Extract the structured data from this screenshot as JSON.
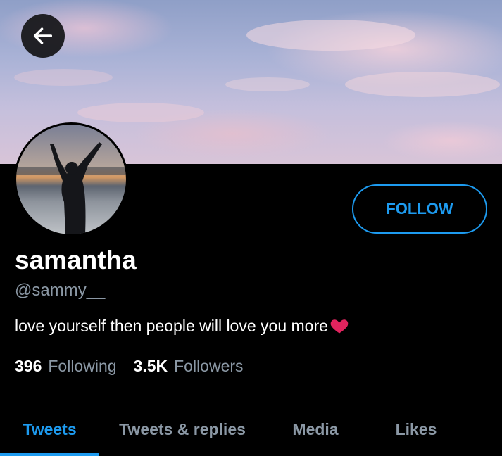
{
  "profile": {
    "name": "samantha",
    "handle": "@sammy__",
    "bio": "love yourself then people will love you more"
  },
  "actions": {
    "follow_label": "FOLLOW"
  },
  "stats": {
    "following_count": "396",
    "following_label": "Following",
    "followers_count": "3.5K",
    "followers_label": "Followers"
  },
  "tabs": [
    {
      "label": "Tweets",
      "active": true
    },
    {
      "label": "Tweets & replies",
      "active": false
    },
    {
      "label": "Media",
      "active": false
    },
    {
      "label": "Likes",
      "active": false
    }
  ],
  "icons": {
    "back": "arrow-left-icon",
    "bio_emoji": "heart-icon"
  },
  "colors": {
    "accent": "#1d9bf0",
    "background": "#000000",
    "secondary_text": "#8b98a5",
    "heart": "#e0245e"
  }
}
